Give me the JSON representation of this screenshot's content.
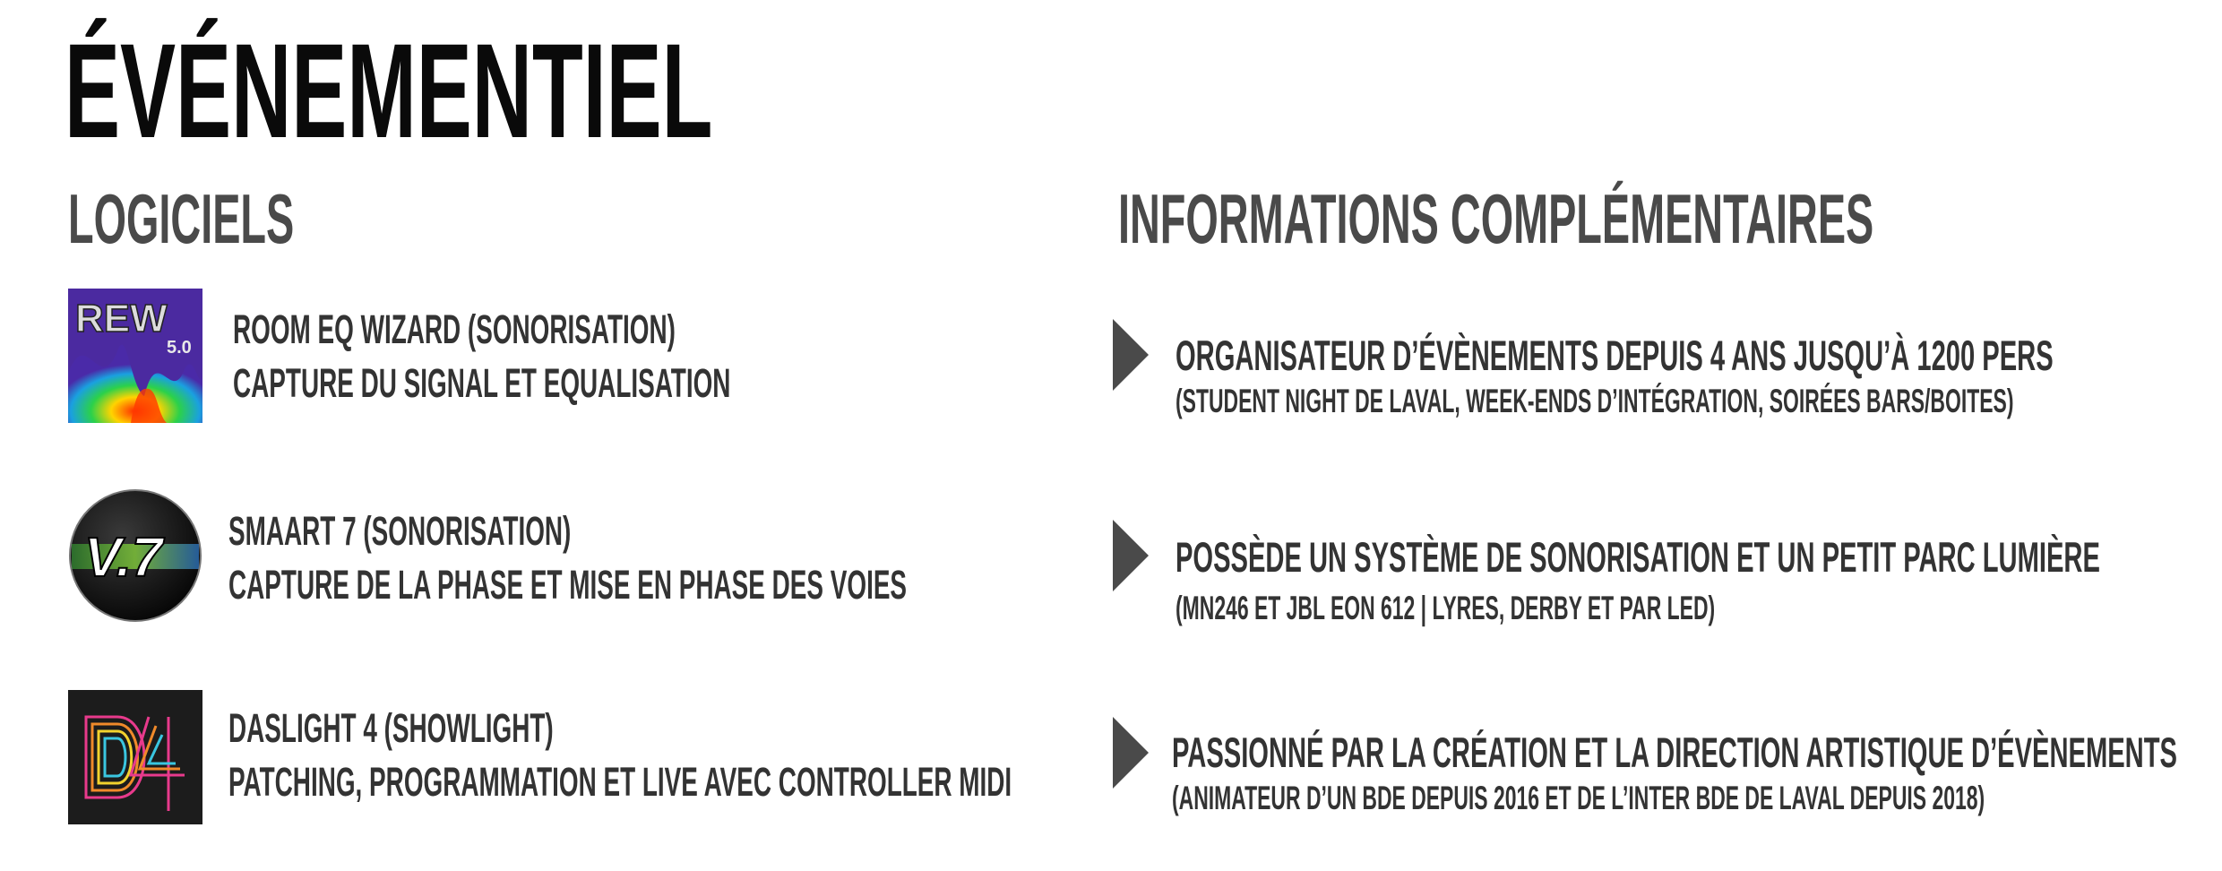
{
  "title": "ÉVÉNEMENTIEL",
  "software": {
    "heading": "LOGICIELS",
    "items": [
      {
        "icon": "rew-icon",
        "icon_label": "REW",
        "icon_version": "5.0",
        "line1": "ROOM EQ WIZARD (SONORISATION)",
        "line2": "CAPTURE DU SIGNAL ET EQUALISATION"
      },
      {
        "icon": "smaart-icon",
        "icon_label": "V.7",
        "line1": "SMAART 7 (SONORISATION)",
        "line2": "CAPTURE DE LA PHASE ET MISE EN PHASE DES VOIES"
      },
      {
        "icon": "daslight-icon",
        "icon_label": "D4",
        "line1": "DASLIGHT 4 (SHOWLIGHT)",
        "line2": "PATCHING, PROGRAMMATION ET LIVE AVEC CONTROLLER MIDI"
      }
    ]
  },
  "info": {
    "heading": "INFORMATIONS COMPLÉMENTAIRES",
    "items": [
      {
        "main": "ORGANISATEUR D’ÉVÈNEMENTS DEPUIS 4 ANS JUSQU’À 1200 PERS",
        "sub": "(STUDENT NIGHT DE LAVAL, WEEK-ENDS D’INTÉGRATION, SOIRÉES BARS/BOITES)"
      },
      {
        "main": "POSSÈDE UN SYSTÈME DE SONORISATION ET UN PETIT PARC LUMIÈRE",
        "sub": "(MN246 ET JBL EON 612 | LYRES, DERBY ET PAR LED)"
      },
      {
        "main": "PASSIONNÉ PAR LA CRÉATION ET LA DIRECTION ARTISTIQUE D’ÉVÈNEMENTS",
        "sub": "(ANIMATEUR D’UN BDE DEPUIS 2016 ET DE L’INTER BDE DE LAVAL DEPUIS 2018)"
      }
    ]
  }
}
